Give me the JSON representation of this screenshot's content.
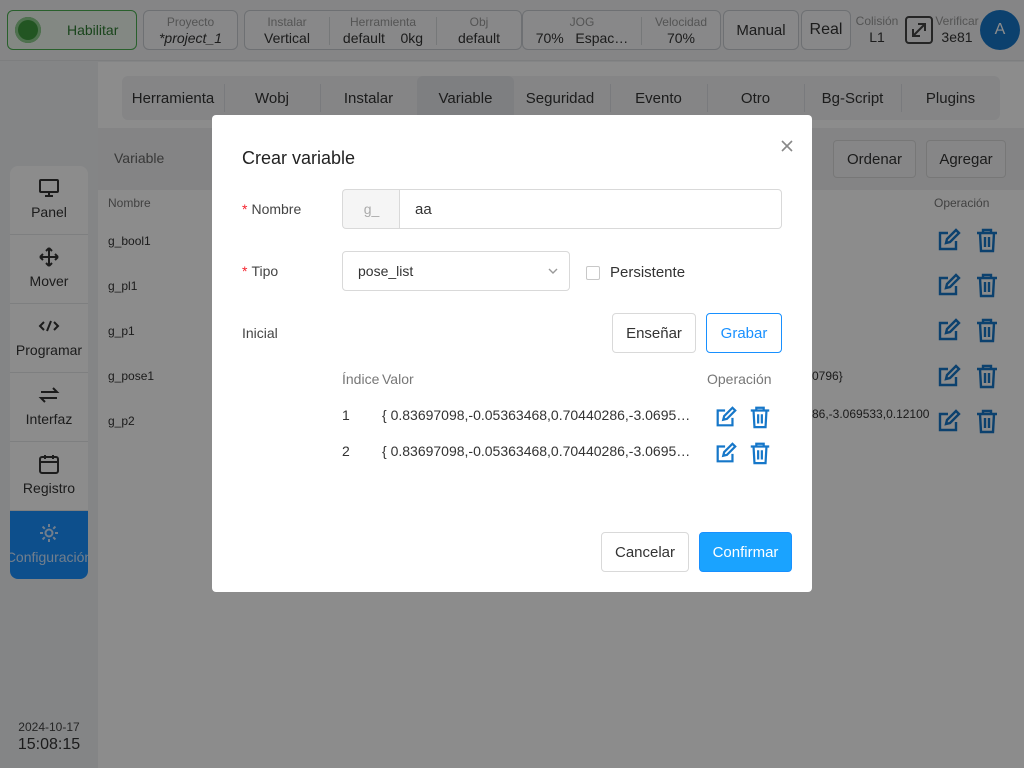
{
  "topbar": {
    "enable_label": "Habilitar",
    "project": {
      "caption": "Proyecto",
      "value": "*project_1"
    },
    "install": {
      "caption": "Instalar",
      "value": "Vertical"
    },
    "tool": {
      "caption": "Herramienta",
      "value": "default",
      "weight": "0kg"
    },
    "obj": {
      "caption": "Obj",
      "value": "default"
    },
    "jog": {
      "caption": "JOG",
      "value": "70%",
      "space": "Espac…"
    },
    "speed": {
      "caption": "Velocidad",
      "value": "70%"
    },
    "mode_button": "Manual",
    "real_button": "Real",
    "collision": {
      "caption": "Colisión",
      "value": "L1"
    },
    "verify": {
      "caption": "Verificar",
      "value": "3e81"
    },
    "avatar_letter": "A"
  },
  "sidebar": {
    "items": [
      {
        "label": "Panel",
        "icon": "monitor-icon"
      },
      {
        "label": "Mover",
        "icon": "move-icon"
      },
      {
        "label": "Programar",
        "icon": "code-icon"
      },
      {
        "label": "Interfaz",
        "icon": "interface-icon"
      },
      {
        "label": "Registro",
        "icon": "calendar-icon"
      },
      {
        "label": "Configuración",
        "icon": "gear-icon",
        "active": true
      }
    ],
    "date": "2024-10-17",
    "time": "15:08:15"
  },
  "tabs": [
    "Herramienta",
    "Wobj",
    "Instalar",
    "Variable",
    "Seguridad",
    "Evento",
    "Otro",
    "Bg-Script",
    "Plugins"
  ],
  "active_tab": "Variable",
  "subbar": {
    "label": "Variable",
    "sort_button": "Ordenar",
    "add_button": "Agregar"
  },
  "table": {
    "col_name": "Nombre",
    "col_operation": "Operación",
    "rows": [
      {
        "name": "g_bool1",
        "value": ""
      },
      {
        "name": "g_pl1",
        "value": ""
      },
      {
        "name": "g_p1",
        "value": ""
      },
      {
        "name": "g_pose1",
        "value": "0796}"
      },
      {
        "name": "g_p2",
        "value": "86,-3.069533,0.12100"
      }
    ]
  },
  "dialog": {
    "title": "Crear variable",
    "name_label": "Nombre",
    "name_prefix": "g_",
    "name_value": "aa",
    "type_label": "Tipo",
    "type_value": "pose_list",
    "persistent_label": "Persistente",
    "persistent_checked": false,
    "initial_label": "Inicial",
    "teach_button": "Enseñar",
    "record_button": "Grabar",
    "col_index": "Índice",
    "col_value": "Valor",
    "col_operation": "Operación",
    "rows": [
      {
        "index": "1",
        "value": "{ 0.83697098,-0.05363468,0.70440286,-3.0695…"
      },
      {
        "index": "2",
        "value": "{ 0.83697098,-0.05363468,0.70440286,-3.0695…"
      }
    ],
    "cancel_button": "Cancelar",
    "confirm_button": "Confirmar"
  },
  "colors": {
    "accent": "#1890ff",
    "enable_green": "#3f9b3f",
    "danger_star": "#f5222d"
  }
}
